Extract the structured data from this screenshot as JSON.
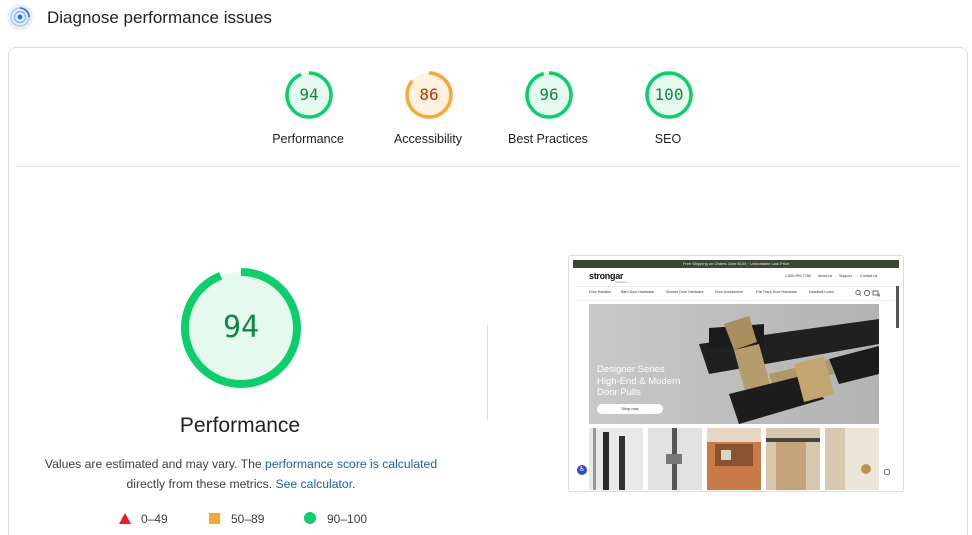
{
  "header": {
    "title": "Diagnose performance issues",
    "icon": "diagnose-icon"
  },
  "scores": [
    {
      "label": "Performance",
      "value": "94",
      "level": 0.94,
      "rating": "pass"
    },
    {
      "label": "Accessibility",
      "value": "86",
      "level": 0.86,
      "rating": "average"
    },
    {
      "label": "Best Practices",
      "value": "96",
      "level": 0.96,
      "rating": "pass"
    },
    {
      "label": "SEO",
      "value": "100",
      "level": 1.0,
      "rating": "pass"
    }
  ],
  "main": {
    "score": "94",
    "level": 0.94,
    "title": "Performance",
    "desc_prefix": "Values are estimated and may vary. The ",
    "desc_link1": "performance score is calculated",
    "desc_middle": " directly from these metrics. ",
    "desc_link2": "See calculator",
    "desc_suffix": "."
  },
  "legend": [
    {
      "shape": "triangle",
      "label": "0–49",
      "color": "#eb1c24"
    },
    {
      "shape": "square",
      "label": "50–89",
      "color": "#fba735"
    },
    {
      "shape": "circle",
      "label": "90–100",
      "color": "#0cce6b"
    }
  ],
  "colors": {
    "pass": "#0cce6b",
    "pass_text": "#0c8a3f",
    "pass_bg": "#e6f9ee",
    "average": "#fba735",
    "average_text": "#c33300",
    "average_bg": "#fff3e0"
  },
  "screenshot": {
    "topbar": "Free Shipping on Orders Over $135 · Unbeatable Low Price",
    "logo": "strongar",
    "logo_sub": "hardware",
    "phone": "1-800-999-7788",
    "util_links": [
      "About us",
      "Support",
      "Contact us"
    ],
    "nav": [
      "Door Handles",
      "Barn Door Hardware",
      "Shower Door Hardware",
      "Door Accessories",
      "Flat Track Door Hardware",
      "Deadbolt Locks"
    ],
    "hero_text": [
      "Designer Series",
      "High-End & Modern",
      "Door Pulls"
    ],
    "hero_button": "Shop now"
  }
}
